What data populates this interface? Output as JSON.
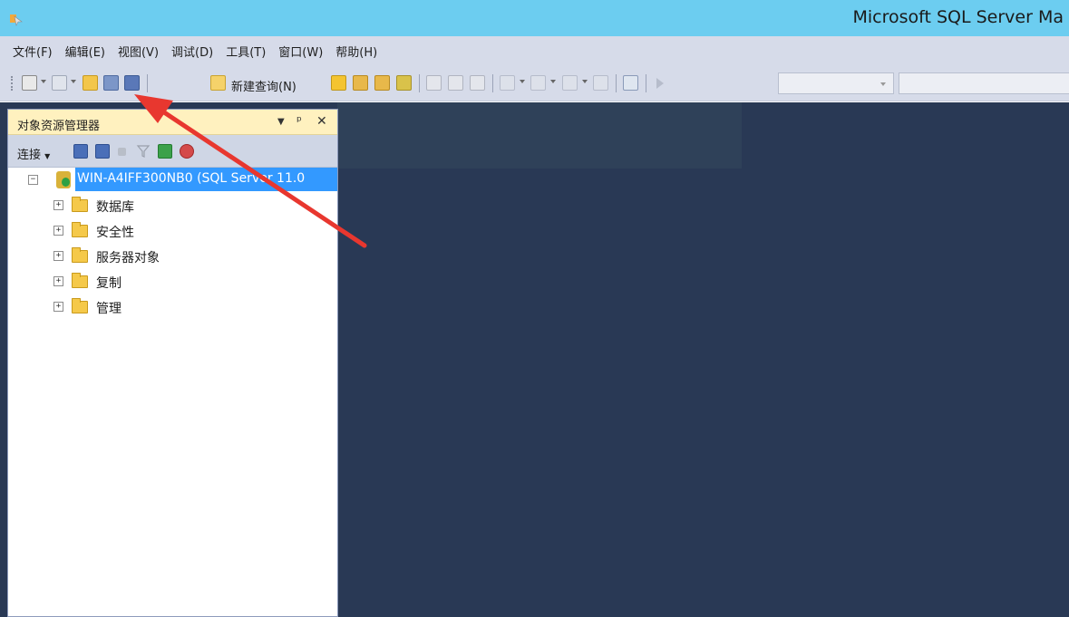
{
  "window": {
    "title": "Microsoft SQL Server Ma"
  },
  "menu": {
    "items": [
      "文件(F)",
      "编辑(E)",
      "视图(V)",
      "调试(D)",
      "工具(T)",
      "窗口(W)",
      "帮助(H)"
    ]
  },
  "toolbar": {
    "new_query_label": "新建查询(N)"
  },
  "object_explorer": {
    "title": "对象资源管理器",
    "connect_label": "连接",
    "server_node": "WIN-A4IFF300NB0 (SQL Server 11.0",
    "nodes": [
      "数据库",
      "安全性",
      "服务器对象",
      "复制",
      "管理"
    ]
  },
  "colors": {
    "titlebar": "#6ccdf0",
    "chrome": "#d6dbe9",
    "workspace": "#293955",
    "selection": "#3399ff",
    "panel_header": "#fff1bf",
    "annotation_arrow": "#e8372f"
  }
}
